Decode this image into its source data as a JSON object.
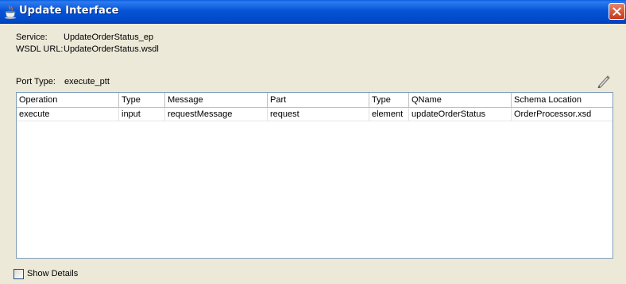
{
  "window": {
    "title": "Update Interface"
  },
  "info": {
    "service_label": "Service:",
    "service_value": "UpdateOrderStatus_ep",
    "wsdl_label": "WSDL URL:",
    "wsdl_value": "UpdateOrderStatus.wsdl",
    "port_type_label": "Port Type:",
    "port_type_value": "execute_ptt"
  },
  "table": {
    "columns": [
      "Operation",
      "Type",
      "Message",
      "Part",
      "Type",
      "QName",
      "Schema Location"
    ],
    "rows": [
      [
        "execute",
        "input",
        "requestMessage",
        "request",
        "element",
        "updateOrderStatus",
        "OrderProcessor.xsd"
      ]
    ]
  },
  "footer": {
    "show_details_label": "Show Details",
    "show_details_checked": false
  },
  "colors": {
    "titlebar": "#0054E3",
    "dialog_bg": "#ECE9D8",
    "close_button": "#D85A3A"
  }
}
